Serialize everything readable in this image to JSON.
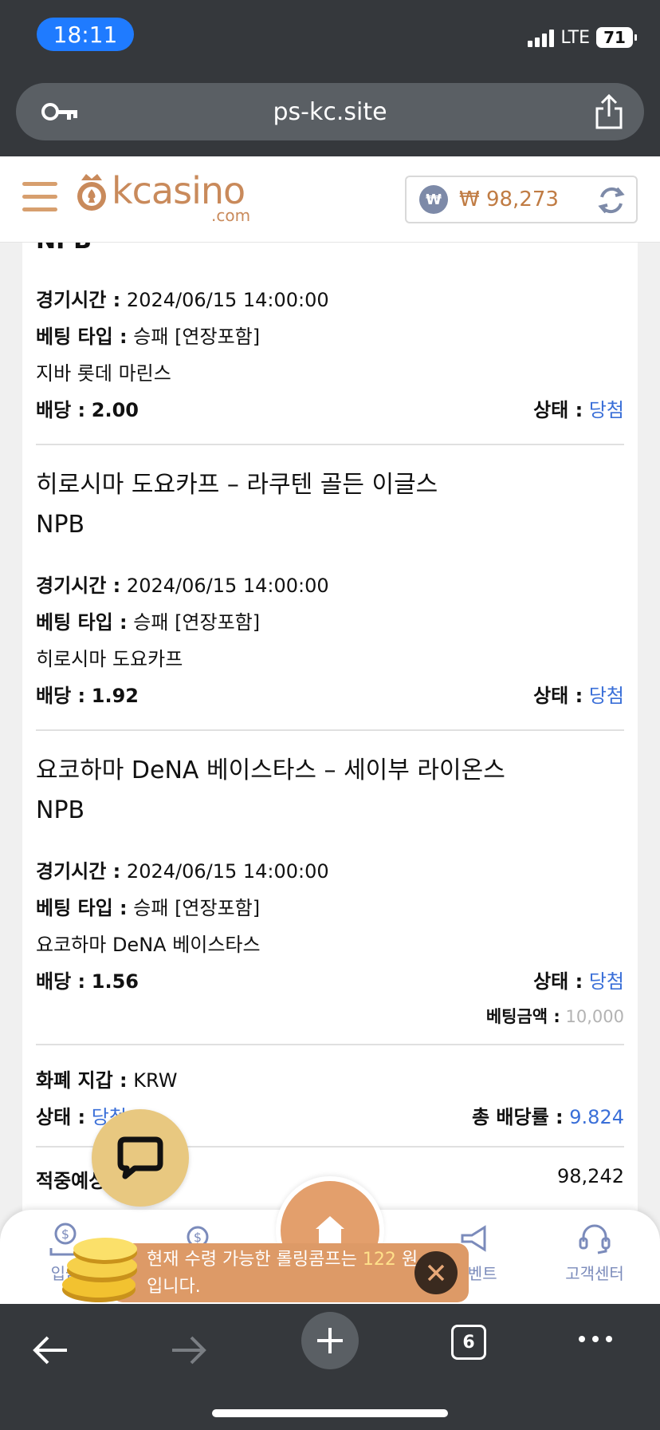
{
  "status_bar": {
    "time": "18:11",
    "network": "LTE",
    "battery": "71"
  },
  "browser": {
    "url": "ps-kc.site",
    "tab_count": "6"
  },
  "site": {
    "logo_text": "kcasino",
    "logo_domain": ".com",
    "balance": "₩ 98,273",
    "won_symbol": "₩"
  },
  "bets": [
    {
      "partial_title": "NPB",
      "time_label": "경기시간 :",
      "time_value": "2024/06/15 14:00:00",
      "type_label": "베팅 타입 :",
      "type_value": "승패 [연장포함]",
      "pick": "지바 롯데 마린스",
      "odds_label": "배당 :",
      "odds_value": "2.00",
      "status_label": "상태 :",
      "status_value": "당첨"
    },
    {
      "title": "히로시마 도요카프 – 라쿠텐 골든 이글스",
      "league": "NPB",
      "time_label": "경기시간 :",
      "time_value": "2024/06/15 14:00:00",
      "type_label": "베팅 타입 :",
      "type_value": "승패 [연장포함]",
      "pick": "히로시마 도요카프",
      "odds_label": "배당 :",
      "odds_value": "1.92",
      "status_label": "상태 :",
      "status_value": "당첨"
    },
    {
      "title": "요코하마 DeNA 베이스타스 – 세이부 라이온스",
      "league": "NPB",
      "time_label": "경기시간 :",
      "time_value": "2024/06/15 14:00:00",
      "type_label": "베팅 타입 :",
      "type_value": "승패 [연장포함]",
      "pick": "요코하마 DeNA 베이스타스",
      "odds_label": "배당 :",
      "odds_value": "1.56",
      "status_label": "상태 :",
      "status_value": "당첨"
    }
  ],
  "summary": {
    "bet_amount_label": "베팅금액 :",
    "bet_amount_value": "10,000",
    "currency_label": "화폐 지갑 :",
    "currency_value": "KRW",
    "status_label": "상태 :",
    "status_value": "당첨",
    "total_odds_label": "총 배당률 :",
    "total_odds_value": "9.824",
    "expected_label": "적중예상",
    "expected_value": "98,242"
  },
  "site_nav": {
    "items": [
      {
        "label": "입금",
        "icon": "deposit-icon"
      },
      {
        "label": "출금",
        "icon": "withdraw-icon"
      },
      {
        "label": "홈",
        "icon": "home-icon"
      },
      {
        "label": "이벤트",
        "icon": "megaphone-icon"
      },
      {
        "label": "고객센터",
        "icon": "headset-icon"
      }
    ]
  },
  "toast": {
    "text_before": "현재 수령 가능한 롤링콤프는",
    "amount": "122",
    "text_after": "원",
    "line2": "입니다."
  },
  "colors": {
    "accent": "#d79f6e",
    "brand": "#c98a5b",
    "blue": "#3a6fd8",
    "chrome": "#35383c"
  }
}
